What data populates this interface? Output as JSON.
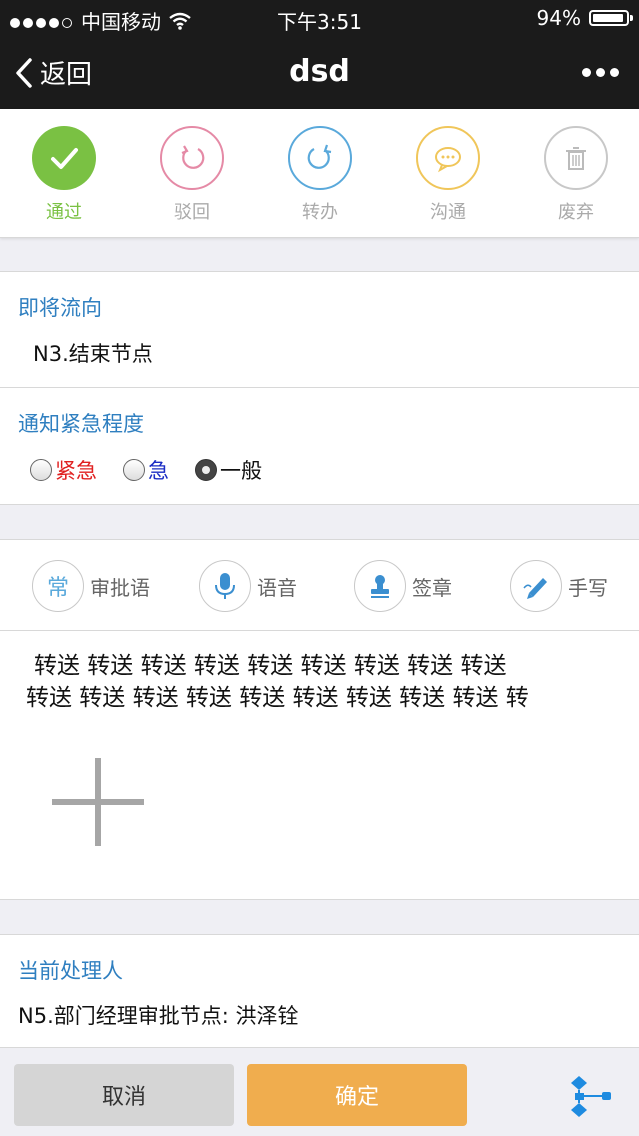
{
  "status_bar": {
    "carrier": "中国移动",
    "time": "下午3:51",
    "battery": "94%",
    "battery_level": 0.94
  },
  "nav": {
    "back_label": "返回",
    "title": "dsd"
  },
  "actions": [
    {
      "label": "通过",
      "color": "#7ac143",
      "icon": "check-icon"
    },
    {
      "label": "驳回",
      "color": "#e58aa6",
      "icon": "undo-icon"
    },
    {
      "label": "转办",
      "color": "#5aa9db",
      "icon": "refresh-icon"
    },
    {
      "label": "沟通",
      "color": "#f0c65a",
      "icon": "chat-icon"
    },
    {
      "label": "废弃",
      "color": "#c8c8c8",
      "icon": "trash-icon"
    }
  ],
  "flow": {
    "title": "即将流向",
    "value": "N3.结束节点"
  },
  "urgency": {
    "title": "通知紧急程度",
    "options": [
      {
        "label": "紧急",
        "color": "#e02020"
      },
      {
        "label": "急",
        "color": "#1a2cc4"
      },
      {
        "label": "一般",
        "color": "#111111"
      }
    ],
    "selected": "一般"
  },
  "tools": [
    {
      "label": "审批语",
      "glyph": "常",
      "icon": "common-phrase-icon"
    },
    {
      "label": "语音",
      "icon": "microphone-icon"
    },
    {
      "label": "签章",
      "icon": "stamp-icon"
    },
    {
      "label": "手写",
      "icon": "pen-icon"
    }
  ],
  "comment": {
    "line1": "转送 转送 转送 转送 转送 转送 转送 转送 转送",
    "line2": "转送 转送 转送 转送 转送 转送 转送 转送 转送 转"
  },
  "handler": {
    "title": "当前处理人",
    "value": "N5.部门经理审批节点: 洪泽铨"
  },
  "footer": {
    "cancel_label": "取消",
    "confirm_label": "确定"
  },
  "colors": {
    "accent_blue": "#2f7fc0",
    "confirm": "#f0ad4e",
    "cancel": "#d5d5d5"
  }
}
